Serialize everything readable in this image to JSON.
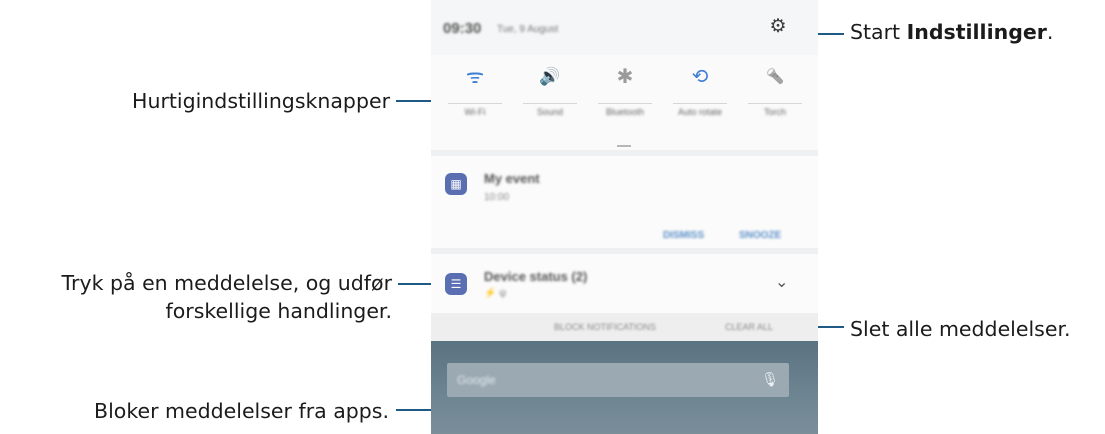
{
  "callouts": {
    "settings": {
      "prefix": "Start ",
      "bold": "Indstillinger",
      "suffix": "."
    },
    "quick_settings": "Hurtigindstillingsknapper",
    "tap_notification_line1": "Tryk på en meddelelse, og udfør",
    "tap_notification_line2": "forskellige handlinger.",
    "clear_all": "Slet alle meddelelser.",
    "block": "Bloker meddelelser fra apps."
  },
  "status_bar": {
    "time": "09:30",
    "date": "Tue, 9 August",
    "settings_icon": "gear-icon"
  },
  "quick_settings": [
    {
      "icon": "wifi-icon",
      "glyph": "ᯤ",
      "label": "Wi-Fi",
      "color": "#3f7fd4"
    },
    {
      "icon": "sound-icon",
      "glyph": "🔊",
      "label": "Sound",
      "color": "#3f7fd4"
    },
    {
      "icon": "bluetooth-icon",
      "glyph": "✱",
      "label": "Bluetooth",
      "color": "#9a9a9a"
    },
    {
      "icon": "auto-rotate-icon",
      "glyph": "⟲",
      "label": "Auto rotate",
      "color": "#3f7fd4"
    },
    {
      "icon": "torch-icon",
      "glyph": "🔦",
      "label": "Torch",
      "color": "#9a9a9a"
    }
  ],
  "notifications": [
    {
      "title": "My event",
      "subtitle": "10:00",
      "actions": [
        "DISMISS",
        "SNOOZE"
      ],
      "icon": "calendar-icon"
    },
    {
      "title": "Device status (2)",
      "subtitle": "⚡ ψ",
      "icon": "list-icon"
    }
  ],
  "bottom_bar": {
    "block": "BLOCK NOTIFICATIONS",
    "clear": "CLEAR ALL"
  },
  "search": {
    "placeholder": "Google"
  },
  "colors": {
    "leader_line": "#1e5a84",
    "accent": "#3f7fd4"
  }
}
